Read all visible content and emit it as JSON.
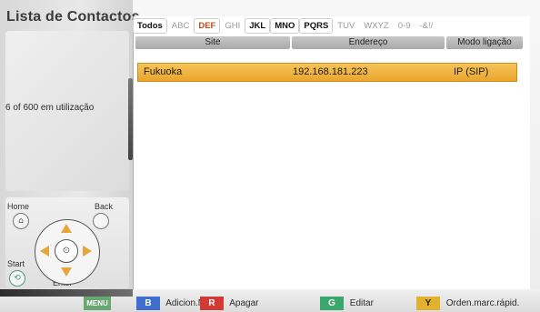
{
  "app": {
    "title": "Lista de Contactos",
    "usage": "6 of 600 em utilização"
  },
  "tabs": [
    "Todos",
    "ABC",
    "DEF",
    "GHI",
    "JKL",
    "MNO",
    "PQRS",
    "TUV",
    "WXYZ",
    "0-9",
    "-&!/"
  ],
  "tab_states": {
    "Todos": "active",
    "DEF": "selected",
    "JKL": "active",
    "MNO": "active",
    "PQRS": "active"
  },
  "table": {
    "headers": [
      "Site",
      "Endereço",
      "Modo ligação"
    ],
    "rows": [
      [
        "Fukuoka",
        "192.168.181.223",
        "IP (SIP)"
      ]
    ]
  },
  "navigation": {
    "home": "Home",
    "back": "Back",
    "start": "Start",
    "enter": "Enter"
  },
  "bottom_keys": {
    "menu": {
      "badge": "MENU",
      "label": ""
    },
    "b": {
      "badge": "B",
      "label": "Adicion.Novo"
    },
    "r": {
      "badge": "R",
      "label": "Apagar"
    },
    "g": {
      "badge": "G",
      "label": "Editar"
    },
    "y": {
      "badge": "Y",
      "label": "Orden.marc.rápid."
    }
  },
  "colors": {
    "highlight": "#eaa52c",
    "blue": "#3f6ed0",
    "red": "#d33a33",
    "green": "#3aa76c",
    "yellow": "#e2b12f"
  }
}
